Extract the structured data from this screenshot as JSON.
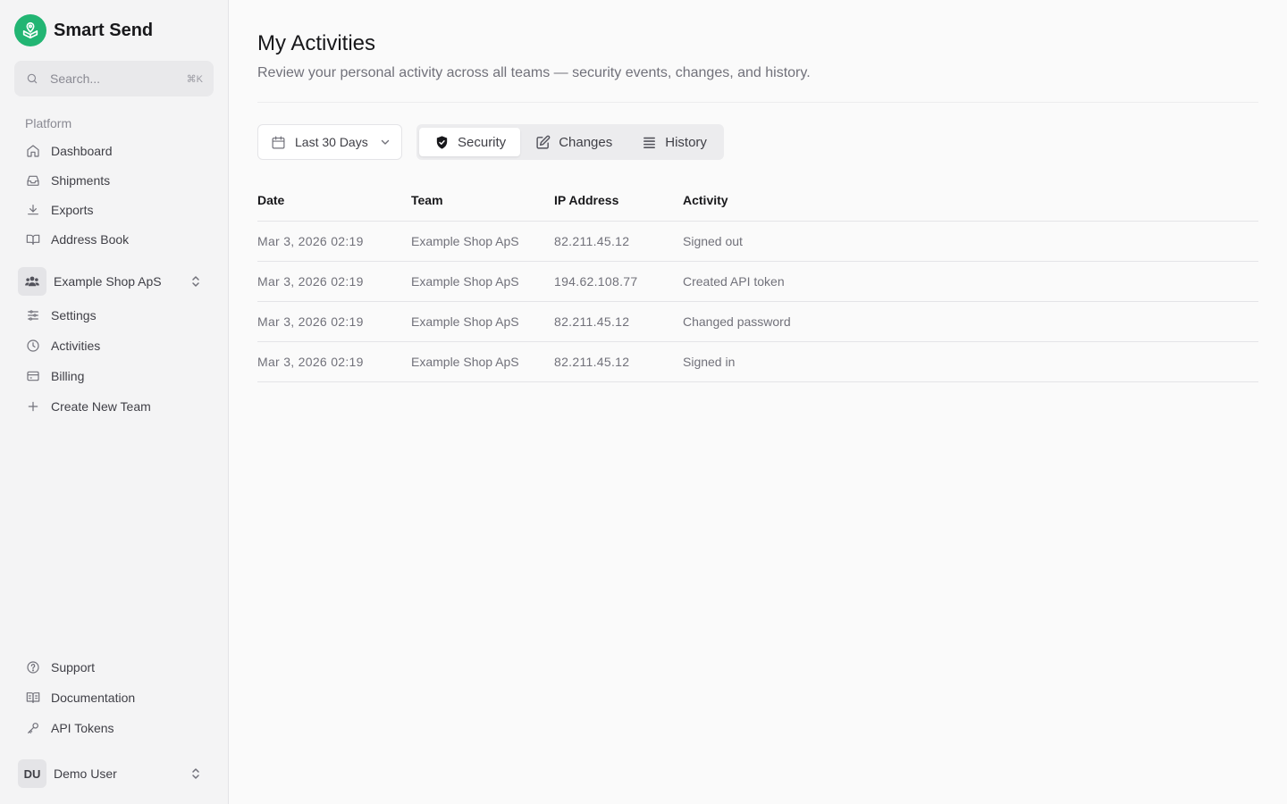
{
  "brand": {
    "name": "Smart Send",
    "accent": "#22b573"
  },
  "search": {
    "placeholder": "Search...",
    "shortcut": "⌘K"
  },
  "sidebar": {
    "platform_label": "Platform",
    "platform_items": [
      {
        "label": "Dashboard",
        "icon": "home-icon"
      },
      {
        "label": "Shipments",
        "icon": "inbox-icon"
      },
      {
        "label": "Exports",
        "icon": "download-icon"
      },
      {
        "label": "Address Book",
        "icon": "book-open-icon"
      }
    ],
    "team": {
      "name": "Example Shop ApS"
    },
    "team_items": [
      {
        "label": "Settings",
        "icon": "sliders-icon"
      },
      {
        "label": "Activities",
        "icon": "clock-icon"
      },
      {
        "label": "Billing",
        "icon": "credit-card-icon"
      },
      {
        "label": "Create New Team",
        "icon": "plus-icon"
      }
    ],
    "bottom_items": [
      {
        "label": "Support",
        "icon": "help-circle-icon"
      },
      {
        "label": "Documentation",
        "icon": "book-text-icon"
      },
      {
        "label": "API Tokens",
        "icon": "key-icon"
      }
    ],
    "user": {
      "initials": "DU",
      "name": "Demo User"
    }
  },
  "main": {
    "title": "My Activities",
    "subtitle": "Review your personal activity across all teams — security events, changes, and history.",
    "date_filter": "Last 30 Days",
    "tabs": [
      {
        "label": "Security",
        "icon": "shield-check-icon",
        "active": true
      },
      {
        "label": "Changes",
        "icon": "edit-icon",
        "active": false
      },
      {
        "label": "History",
        "icon": "list-icon",
        "active": false
      }
    ],
    "table": {
      "headers": {
        "date": "Date",
        "team": "Team",
        "ip": "IP Address",
        "activity": "Activity"
      },
      "rows": [
        {
          "date": "Mar 3, 2026 02:19",
          "team": "Example Shop ApS",
          "ip": "82.211.45.12",
          "activity": "Signed out"
        },
        {
          "date": "Mar 3, 2026 02:19",
          "team": "Example Shop ApS",
          "ip": "194.62.108.77",
          "activity": "Created API token"
        },
        {
          "date": "Mar 3, 2026 02:19",
          "team": "Example Shop ApS",
          "ip": "82.211.45.12",
          "activity": "Changed password"
        },
        {
          "date": "Mar 3, 2026 02:19",
          "team": "Example Shop ApS",
          "ip": "82.211.45.12",
          "activity": "Signed in"
        }
      ]
    }
  }
}
